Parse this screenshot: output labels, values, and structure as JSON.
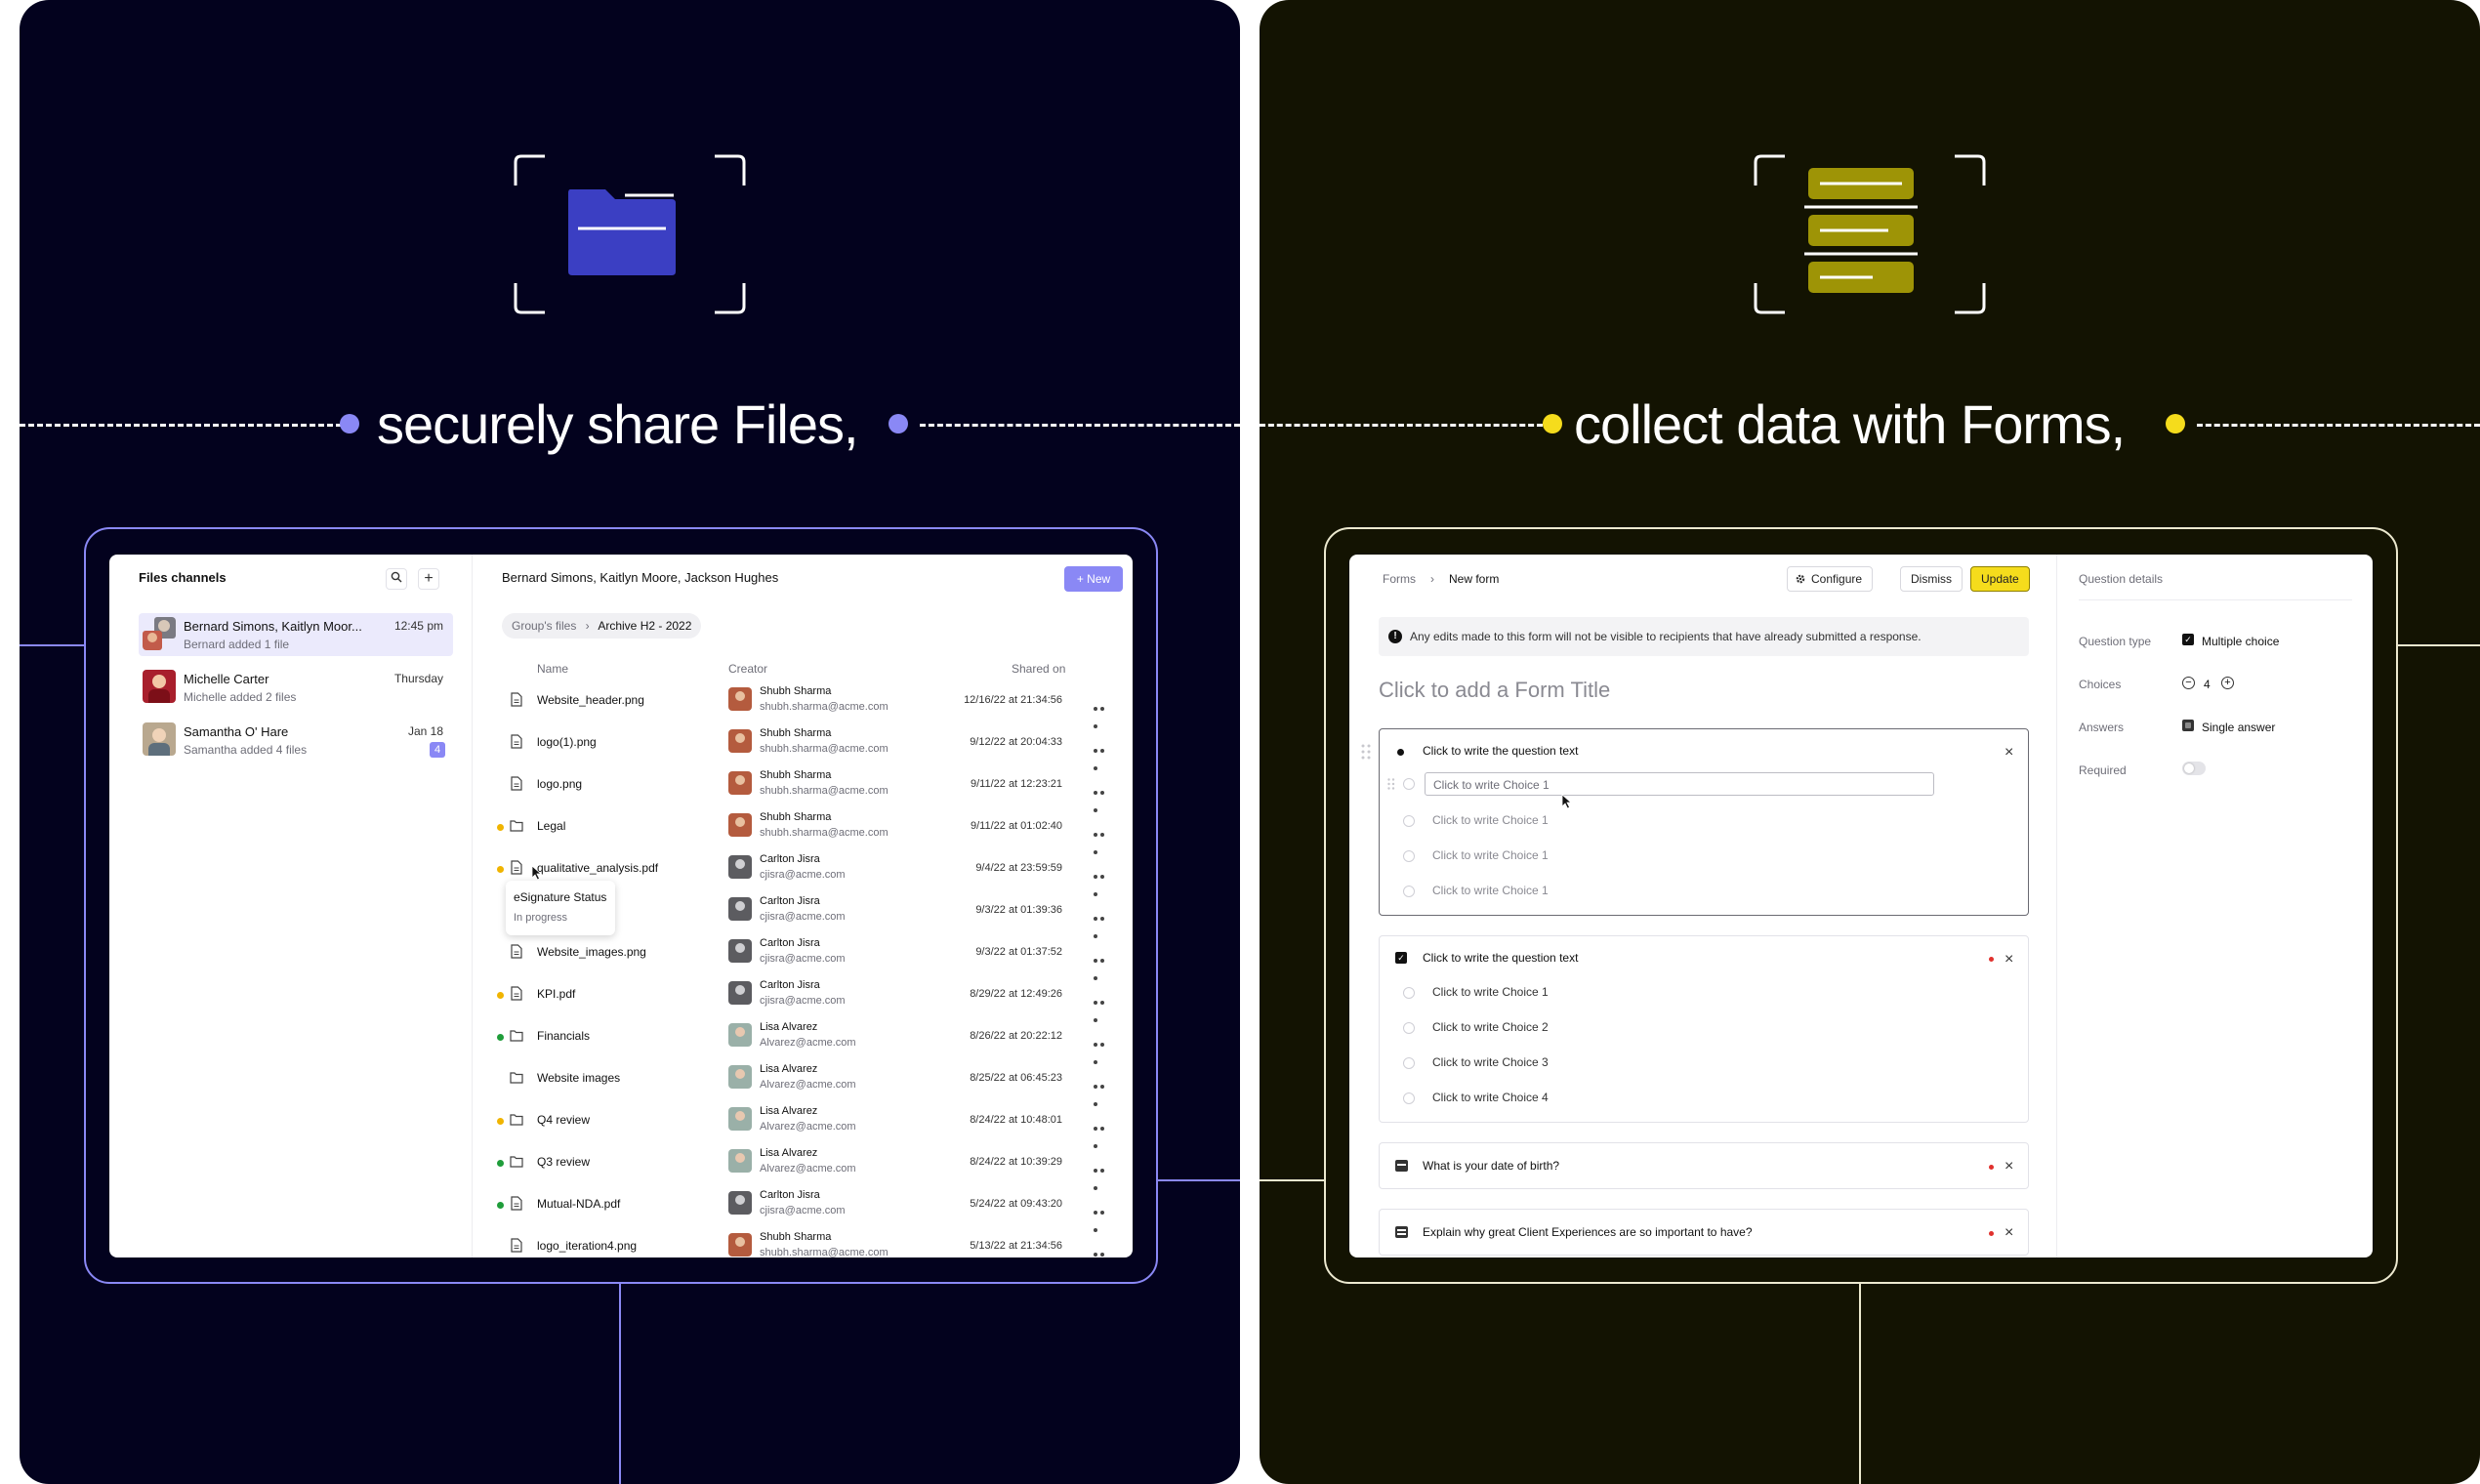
{
  "left": {
    "headline": "securely share Files,",
    "accent": "#8a88f5",
    "icon": "folder-icon",
    "app": {
      "sidebar": {
        "title": "Files channels",
        "items": [
          {
            "name": "Bernard Simons, Kaitlyn Moor...",
            "time": "12:45 pm",
            "sub": "Bernard added 1 file",
            "badge": ""
          },
          {
            "name": "Michelle Carter",
            "time": "Thursday",
            "sub": "Michelle added 2 files",
            "badge": ""
          },
          {
            "name": "Samantha O' Hare",
            "time": "Jan 18",
            "sub": "Samantha added 4 files",
            "badge": "4"
          }
        ]
      },
      "header": {
        "title": "Bernard Simons, Kaitlyn Moore, Jackson Hughes",
        "new_label": "+ New"
      },
      "breadcrumb": {
        "root": "Group's files",
        "sep": "›",
        "current": "Archive H2 - 2022"
      },
      "columns": {
        "name": "Name",
        "creator": "Creator",
        "shared": "Shared on"
      },
      "rows": [
        {
          "name": "Website_header.png",
          "type": "file",
          "status": "",
          "creator": "Shubh Sharma",
          "email": "shubh.sharma@acme.com",
          "date": "12/16/22 at 21:34:56"
        },
        {
          "name": "logo(1).png",
          "type": "file",
          "status": "",
          "creator": "Shubh Sharma",
          "email": "shubh.sharma@acme.com",
          "date": "9/12/22 at 20:04:33"
        },
        {
          "name": "logo.png",
          "type": "file",
          "status": "",
          "creator": "Shubh Sharma",
          "email": "shubh.sharma@acme.com",
          "date": "9/11/22 at 12:23:21"
        },
        {
          "name": "Legal",
          "type": "folder",
          "status": "#f0b400",
          "creator": "Shubh Sharma",
          "email": "shubh.sharma@acme.com",
          "date": "9/11/22 at 01:02:40"
        },
        {
          "name": "qualitative_analysis.pdf",
          "type": "file",
          "status": "#f0b400",
          "creator": "Carlton Jisra",
          "email": "cjisra@acme.com",
          "date": "9/4/22 at 23:59:59"
        },
        {
          "name": "",
          "type": "file",
          "status": "",
          "creator": "Carlton Jisra",
          "email": "cjisra@acme.com",
          "date": "9/3/22 at 01:39:36"
        },
        {
          "name": "Website_images.png",
          "type": "file",
          "status": "",
          "creator": "Carlton Jisra",
          "email": "cjisra@acme.com",
          "date": "9/3/22 at 01:37:52"
        },
        {
          "name": "KPI.pdf",
          "type": "file",
          "status": "#f0b400",
          "creator": "Carlton Jisra",
          "email": "cjisra@acme.com",
          "date": "8/29/22 at 12:49:26"
        },
        {
          "name": "Financials",
          "type": "folder",
          "status": "#1f9d3a",
          "creator": "Lisa Alvarez",
          "email": "Alvarez@acme.com",
          "date": "8/26/22 at 20:22:12"
        },
        {
          "name": "Website images",
          "type": "folder",
          "status": "",
          "creator": "Lisa Alvarez",
          "email": "Alvarez@acme.com",
          "date": "8/25/22 at 06:45:23"
        },
        {
          "name": "Q4 review",
          "type": "folder",
          "status": "#f0b400",
          "creator": "Lisa Alvarez",
          "email": "Alvarez@acme.com",
          "date": "8/24/22 at 10:48:01"
        },
        {
          "name": "Q3 review",
          "type": "folder",
          "status": "#1f9d3a",
          "creator": "Lisa Alvarez",
          "email": "Alvarez@acme.com",
          "date": "8/24/22 at 10:39:29"
        },
        {
          "name": "Mutual-NDA.pdf",
          "type": "file",
          "status": "#1f9d3a",
          "creator": "Carlton Jisra",
          "email": "cjisra@acme.com",
          "date": "5/24/22 at 09:43:20"
        },
        {
          "name": "logo_iteration4.png",
          "type": "file",
          "status": "",
          "creator": "Shubh Sharma",
          "email": "shubh.sharma@acme.com",
          "date": "5/13/22 at 21:34:56"
        }
      ],
      "tooltip": {
        "title": "eSignature Status",
        "value": "In progress"
      }
    }
  },
  "right": {
    "headline": "collect data with Forms,",
    "accent": "#f5dc1c",
    "icon": "form-list-icon",
    "app": {
      "breadcrumb": {
        "root": "Forms",
        "sep": "›",
        "current": "New form"
      },
      "buttons": {
        "configure": "Configure",
        "dismiss": "Dismiss",
        "update": "Update"
      },
      "notice": "Any edits made to this form will not be visible to recipients that have already submitted a response.",
      "form_title_placeholder": "Click to add a Form Title",
      "q1": {
        "text": "Click to write the question text",
        "input_placeholder": "Click to write Choice 1",
        "choices": [
          "Click to write Choice 1",
          "Click to write Choice 1",
          "Click to write Choice 1"
        ]
      },
      "q2": {
        "text": "Click to write the question text",
        "choices": [
          "Click to write Choice 1",
          "Click to write Choice 2",
          "Click to write Choice 3",
          "Click to write Choice 4"
        ]
      },
      "q3": {
        "text": "What is your date of birth?"
      },
      "q4": {
        "text": "Explain why great Client Experiences are so important to have?"
      },
      "details": {
        "title": "Question details",
        "type_label": "Question type",
        "type_value": "Multiple choice",
        "choices_label": "Choices",
        "choices_value": "4",
        "answers_label": "Answers",
        "answers_value": "Single answer",
        "required_label": "Required"
      }
    }
  }
}
